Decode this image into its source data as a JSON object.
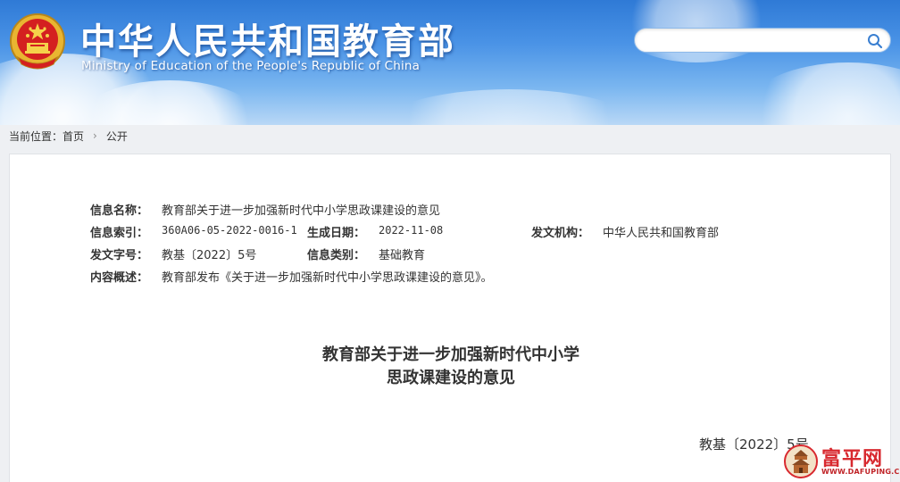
{
  "header": {
    "title_cn": "中华人民共和国教育部",
    "title_en": "Ministry of Education of the People's Republic of China",
    "emblem_icon": "national-emblem-icon",
    "search": {
      "placeholder": "",
      "value": "",
      "icon": "search-icon"
    }
  },
  "breadcrumb": {
    "label": "当前位置：",
    "items": [
      "首页",
      "公开"
    ],
    "separator_icon": "chevron-right-icon"
  },
  "meta": {
    "name_label": "信息名称：",
    "name_value": "教育部关于进一步加强新时代中小学思政课建设的意见",
    "index_label": "信息索引：",
    "index_value": "360A06-05-2022-0016-1",
    "date_label": "生成日期：",
    "date_value": "2022-11-08",
    "org_label": "发文机构：",
    "org_value": "中华人民共和国教育部",
    "docno_label": "发文字号：",
    "docno_value": "教基〔2022〕5号",
    "category_label": "信息类别：",
    "category_value": "基础教育",
    "summary_label": "内容概述：",
    "summary_value": "教育部发布《关于进一步加强新时代中小学思政课建设的意见》。"
  },
  "document": {
    "title_line1": "教育部关于进一步加强新时代中小学",
    "title_line2": "思政课建设的意见",
    "number": "教基〔2022〕5号"
  },
  "watermark": {
    "brand": "富平网",
    "url": "WWW.DAFUPING.CN"
  },
  "colors": {
    "header_blue": "#2f7ad6",
    "watermark_red": "#d8292f"
  }
}
